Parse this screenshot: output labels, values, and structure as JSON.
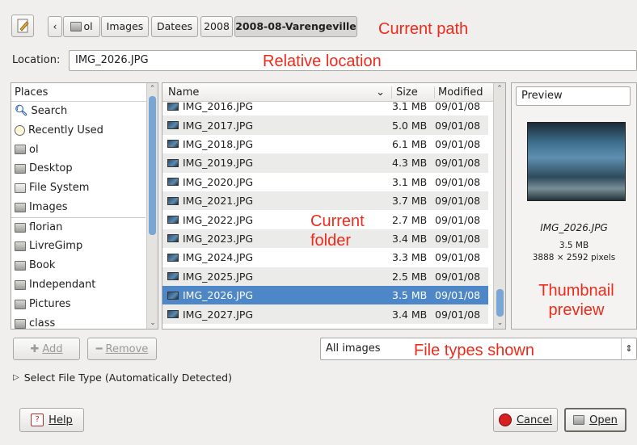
{
  "toolbar": {
    "edit_icon": "pencil-edit-icon",
    "back_label": "‹",
    "crumbs": [
      {
        "label": "ol"
      },
      {
        "label": "Images"
      },
      {
        "label": "Datees"
      },
      {
        "label": "2008"
      },
      {
        "label": "2008-08-Varengeville"
      }
    ]
  },
  "annotations": {
    "current_path": "Current path",
    "relative_location": "Relative location",
    "current_folder_line1": "Current",
    "current_folder_line2": "folder",
    "thumbnail_line1": "Thumbnail",
    "thumbnail_line2": "preview",
    "file_types": "File types shown"
  },
  "location": {
    "label": "Location:",
    "value": "IMG_2026.JPG"
  },
  "places": {
    "header": "Places",
    "items": [
      {
        "label": "Search",
        "icon": "search-icon"
      },
      {
        "label": "Recently Used",
        "icon": "clock-icon"
      },
      {
        "label": "ol",
        "icon": "home-folder-icon"
      },
      {
        "label": "Desktop",
        "icon": "desktop-folder-icon"
      },
      {
        "label": "File System",
        "icon": "drive-icon"
      },
      {
        "label": "Images",
        "icon": "folder-icon"
      },
      {
        "label": "florian",
        "icon": "folder-icon"
      },
      {
        "label": "LivreGimp",
        "icon": "folder-icon"
      },
      {
        "label": "Book",
        "icon": "folder-icon"
      },
      {
        "label": "Independant",
        "icon": "folder-icon"
      },
      {
        "label": "Pictures",
        "icon": "folder-icon"
      },
      {
        "label": "class",
        "icon": "folder-icon"
      }
    ],
    "add_label": "Add",
    "remove_label": "Remove"
  },
  "files": {
    "columns": {
      "name": "Name",
      "size": "Size",
      "modified": "Modified"
    },
    "rows": [
      {
        "name": "IMG_2016.JPG",
        "size": "3.1 MB",
        "modified": "09/01/08"
      },
      {
        "name": "IMG_2017.JPG",
        "size": "5.0 MB",
        "modified": "09/01/08"
      },
      {
        "name": "IMG_2018.JPG",
        "size": "6.1 MB",
        "modified": "09/01/08"
      },
      {
        "name": "IMG_2019.JPG",
        "size": "4.3 MB",
        "modified": "09/01/08"
      },
      {
        "name": "IMG_2020.JPG",
        "size": "3.1 MB",
        "modified": "09/01/08"
      },
      {
        "name": "IMG_2021.JPG",
        "size": "3.7 MB",
        "modified": "09/01/08"
      },
      {
        "name": "IMG_2022.JPG",
        "size": "2.7 MB",
        "modified": "09/01/08"
      },
      {
        "name": "IMG_2023.JPG",
        "size": "3.4 MB",
        "modified": "09/01/08"
      },
      {
        "name": "IMG_2024.JPG",
        "size": "3.3 MB",
        "modified": "09/01/08"
      },
      {
        "name": "IMG_2025.JPG",
        "size": "2.5 MB",
        "modified": "09/01/08"
      },
      {
        "name": "IMG_2026.JPG",
        "size": "3.5 MB",
        "modified": "09/01/08",
        "selected": true
      },
      {
        "name": "IMG_2027.JPG",
        "size": "3.4 MB",
        "modified": "09/01/08"
      }
    ]
  },
  "preview": {
    "dropdown_label": "Preview",
    "filename": "IMG_2026.JPG",
    "size": "3.5 MB",
    "dimensions": "3888 × 2592 pixels"
  },
  "filter": {
    "value": "All images"
  },
  "select_file_type": {
    "label": "Select File Type (Automatically Detected)"
  },
  "buttons": {
    "help": "Help",
    "cancel": "Cancel",
    "open": "Open"
  },
  "colors": {
    "selection": "#4e87c7",
    "annotation": "#f02a1a"
  }
}
